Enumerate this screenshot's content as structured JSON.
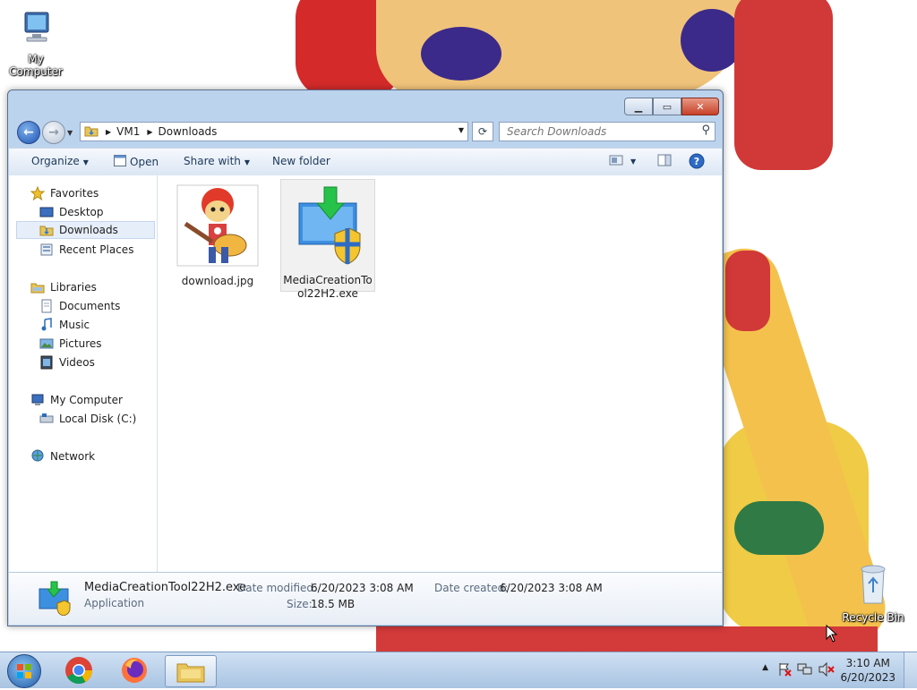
{
  "desktop": {
    "icons": [
      {
        "label": "My Computer",
        "icon": "computer-icon"
      },
      {
        "label": "Recycle Bin",
        "icon": "recycle-bin-icon"
      }
    ]
  },
  "window": {
    "caption_buttons": {
      "minimize": "minimize-icon",
      "maximize": "maximize-icon",
      "close": "close-icon"
    },
    "address": {
      "parts": [
        "VM1",
        "Downloads"
      ]
    },
    "search": {
      "placeholder": "Search Downloads"
    },
    "toolbar": {
      "organize": "Organize",
      "open": "Open",
      "share_with": "Share with",
      "new_folder": "New folder"
    },
    "nav": {
      "favorites": "Favorites",
      "desktop": "Desktop",
      "downloads": "Downloads",
      "recent_places": "Recent Places",
      "libraries": "Libraries",
      "documents": "Documents",
      "music": "Music",
      "pictures": "Pictures",
      "videos": "Videos",
      "my_computer": "My Computer",
      "local_disk": "Local Disk (C:)",
      "network": "Network"
    },
    "files": [
      {
        "name": "download.jpg"
      },
      {
        "name": "MediaCreationTo\nol22H2.exe"
      }
    ],
    "details": {
      "name": "MediaCreationTool22H2.exe",
      "type": "Application",
      "date_modified_label": "Date modified:",
      "date_modified": "6/20/2023 3:08 AM",
      "size_label": "Size:",
      "size": "18.5 MB",
      "date_created_label": "Date created:",
      "date_created": "6/20/2023 3:08 AM"
    }
  },
  "taskbar": {
    "apps": [
      "start-orb",
      "chrome-icon",
      "firefox-icon",
      "explorer-icon"
    ],
    "clock": {
      "time": "3:10 AM",
      "date": "6/20/2023"
    }
  }
}
